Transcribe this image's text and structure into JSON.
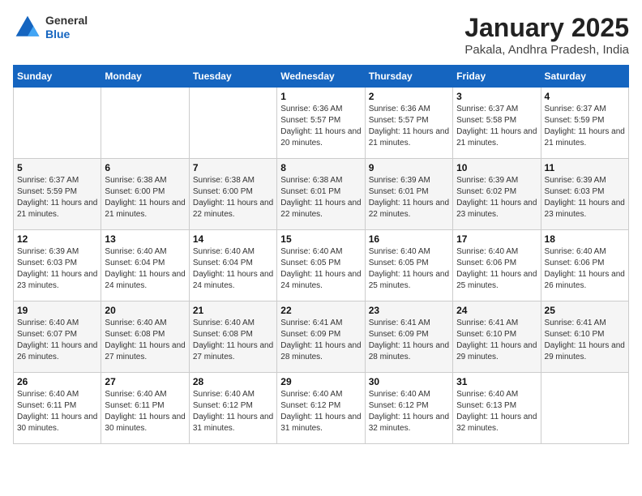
{
  "header": {
    "logo_general": "General",
    "logo_blue": "Blue",
    "month_title": "January 2025",
    "location": "Pakala, Andhra Pradesh, India"
  },
  "weekdays": [
    "Sunday",
    "Monday",
    "Tuesday",
    "Wednesday",
    "Thursday",
    "Friday",
    "Saturday"
  ],
  "weeks": [
    [
      {
        "day": "",
        "info": ""
      },
      {
        "day": "",
        "info": ""
      },
      {
        "day": "",
        "info": ""
      },
      {
        "day": "1",
        "info": "Sunrise: 6:36 AM\nSunset: 5:57 PM\nDaylight: 11 hours and 20 minutes."
      },
      {
        "day": "2",
        "info": "Sunrise: 6:36 AM\nSunset: 5:57 PM\nDaylight: 11 hours and 21 minutes."
      },
      {
        "day": "3",
        "info": "Sunrise: 6:37 AM\nSunset: 5:58 PM\nDaylight: 11 hours and 21 minutes."
      },
      {
        "day": "4",
        "info": "Sunrise: 6:37 AM\nSunset: 5:59 PM\nDaylight: 11 hours and 21 minutes."
      }
    ],
    [
      {
        "day": "5",
        "info": "Sunrise: 6:37 AM\nSunset: 5:59 PM\nDaylight: 11 hours and 21 minutes."
      },
      {
        "day": "6",
        "info": "Sunrise: 6:38 AM\nSunset: 6:00 PM\nDaylight: 11 hours and 21 minutes."
      },
      {
        "day": "7",
        "info": "Sunrise: 6:38 AM\nSunset: 6:00 PM\nDaylight: 11 hours and 22 minutes."
      },
      {
        "day": "8",
        "info": "Sunrise: 6:38 AM\nSunset: 6:01 PM\nDaylight: 11 hours and 22 minutes."
      },
      {
        "day": "9",
        "info": "Sunrise: 6:39 AM\nSunset: 6:01 PM\nDaylight: 11 hours and 22 minutes."
      },
      {
        "day": "10",
        "info": "Sunrise: 6:39 AM\nSunset: 6:02 PM\nDaylight: 11 hours and 23 minutes."
      },
      {
        "day": "11",
        "info": "Sunrise: 6:39 AM\nSunset: 6:03 PM\nDaylight: 11 hours and 23 minutes."
      }
    ],
    [
      {
        "day": "12",
        "info": "Sunrise: 6:39 AM\nSunset: 6:03 PM\nDaylight: 11 hours and 23 minutes."
      },
      {
        "day": "13",
        "info": "Sunrise: 6:40 AM\nSunset: 6:04 PM\nDaylight: 11 hours and 24 minutes."
      },
      {
        "day": "14",
        "info": "Sunrise: 6:40 AM\nSunset: 6:04 PM\nDaylight: 11 hours and 24 minutes."
      },
      {
        "day": "15",
        "info": "Sunrise: 6:40 AM\nSunset: 6:05 PM\nDaylight: 11 hours and 24 minutes."
      },
      {
        "day": "16",
        "info": "Sunrise: 6:40 AM\nSunset: 6:05 PM\nDaylight: 11 hours and 25 minutes."
      },
      {
        "day": "17",
        "info": "Sunrise: 6:40 AM\nSunset: 6:06 PM\nDaylight: 11 hours and 25 minutes."
      },
      {
        "day": "18",
        "info": "Sunrise: 6:40 AM\nSunset: 6:06 PM\nDaylight: 11 hours and 26 minutes."
      }
    ],
    [
      {
        "day": "19",
        "info": "Sunrise: 6:40 AM\nSunset: 6:07 PM\nDaylight: 11 hours and 26 minutes."
      },
      {
        "day": "20",
        "info": "Sunrise: 6:40 AM\nSunset: 6:08 PM\nDaylight: 11 hours and 27 minutes."
      },
      {
        "day": "21",
        "info": "Sunrise: 6:40 AM\nSunset: 6:08 PM\nDaylight: 11 hours and 27 minutes."
      },
      {
        "day": "22",
        "info": "Sunrise: 6:41 AM\nSunset: 6:09 PM\nDaylight: 11 hours and 28 minutes."
      },
      {
        "day": "23",
        "info": "Sunrise: 6:41 AM\nSunset: 6:09 PM\nDaylight: 11 hours and 28 minutes."
      },
      {
        "day": "24",
        "info": "Sunrise: 6:41 AM\nSunset: 6:10 PM\nDaylight: 11 hours and 29 minutes."
      },
      {
        "day": "25",
        "info": "Sunrise: 6:41 AM\nSunset: 6:10 PM\nDaylight: 11 hours and 29 minutes."
      }
    ],
    [
      {
        "day": "26",
        "info": "Sunrise: 6:40 AM\nSunset: 6:11 PM\nDaylight: 11 hours and 30 minutes."
      },
      {
        "day": "27",
        "info": "Sunrise: 6:40 AM\nSunset: 6:11 PM\nDaylight: 11 hours and 30 minutes."
      },
      {
        "day": "28",
        "info": "Sunrise: 6:40 AM\nSunset: 6:12 PM\nDaylight: 11 hours and 31 minutes."
      },
      {
        "day": "29",
        "info": "Sunrise: 6:40 AM\nSunset: 6:12 PM\nDaylight: 11 hours and 31 minutes."
      },
      {
        "day": "30",
        "info": "Sunrise: 6:40 AM\nSunset: 6:12 PM\nDaylight: 11 hours and 32 minutes."
      },
      {
        "day": "31",
        "info": "Sunrise: 6:40 AM\nSunset: 6:13 PM\nDaylight: 11 hours and 32 minutes."
      },
      {
        "day": "",
        "info": ""
      }
    ]
  ]
}
